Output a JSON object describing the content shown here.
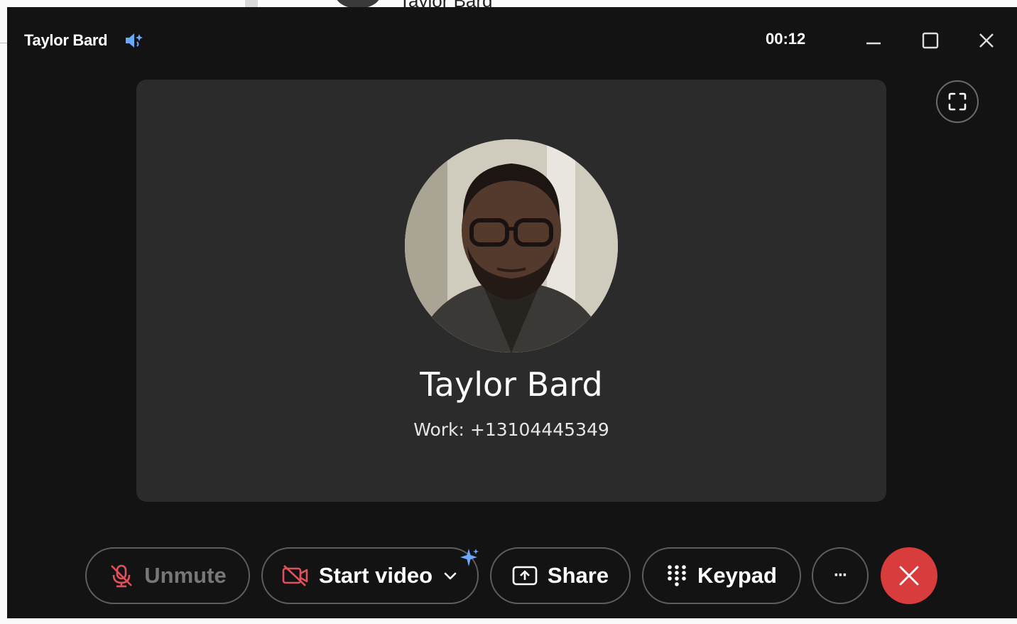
{
  "background": {
    "name_partial": "Taylor Bard"
  },
  "window": {
    "title": "Taylor Bard",
    "timer": "00:12"
  },
  "contact": {
    "name": "Taylor Bard",
    "number": "Work: +13104445349"
  },
  "controls": {
    "unmute_label": "Unmute",
    "start_video_label": "Start video",
    "share_label": "Share",
    "keypad_label": "Keypad",
    "more_label": "···"
  },
  "icons": {
    "speaker": "speaker-sparkle-icon",
    "minimize": "minimize-icon",
    "maximize": "maximize-icon",
    "close": "close-icon",
    "fullscreen": "fullscreen-icon",
    "mic_off": "mic-off-icon",
    "video_off": "video-off-icon",
    "chevron": "chevron-down-icon",
    "share": "share-screen-icon",
    "keypad": "keypad-icon",
    "end_call": "end-call-icon"
  },
  "colors": {
    "window_bg": "#131313",
    "stage_bg": "#2b2b2b",
    "end_call": "#d93c3c",
    "muted_red": "#e0525a",
    "accent_blue": "#6aa8ff"
  }
}
